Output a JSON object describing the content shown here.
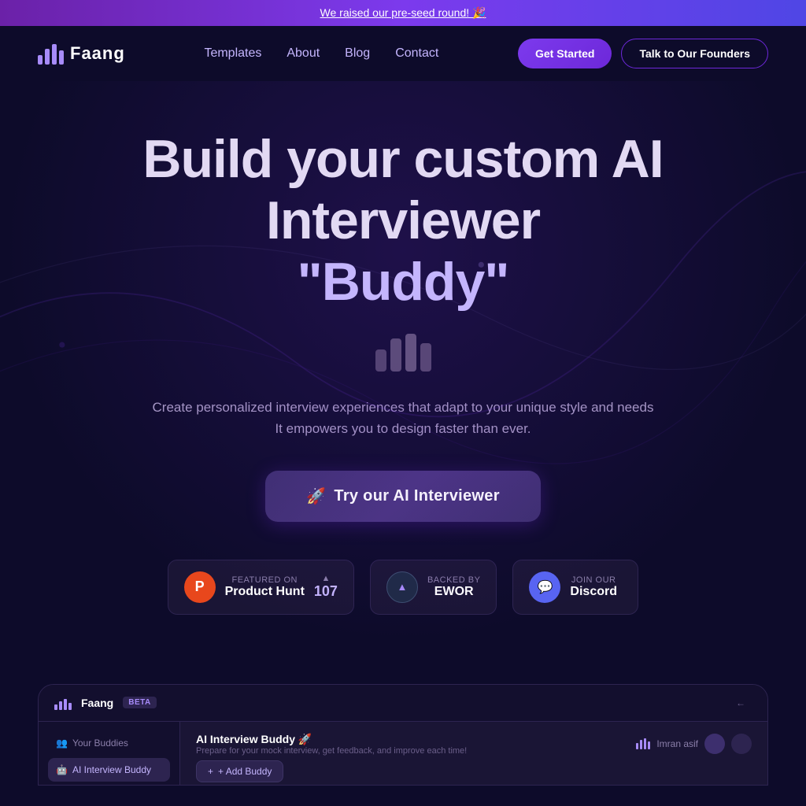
{
  "banner": {
    "text": "We raised our pre-seed round! 🎉"
  },
  "navbar": {
    "logo_text": "Faang",
    "links": [
      {
        "label": "Templates",
        "href": "#"
      },
      {
        "label": "About",
        "href": "#"
      },
      {
        "label": "Blog",
        "href": "#"
      },
      {
        "label": "Contact",
        "href": "#"
      }
    ],
    "btn_get_started": "Get Started",
    "btn_founders": "Talk to Our Founders"
  },
  "hero": {
    "title_line1": "Build your custom AI",
    "title_line2": "Interviewer",
    "title_line3": "\"Buddy\"",
    "subtitle_line1": "Create personalized interview experiences that adapt to your unique style and needs",
    "subtitle_line2": "It empowers you to design faster than ever.",
    "cta_label": "Try our AI Interviewer"
  },
  "badges": [
    {
      "icon_label": "P",
      "icon_style": "ph",
      "small_text": "FEATURED ON",
      "main_text": "Product Hunt",
      "count": "107"
    },
    {
      "icon_label": "▲",
      "icon_style": "ew",
      "small_text": "Backed by",
      "main_text": "EWOR",
      "count": ""
    },
    {
      "icon_label": "💬",
      "icon_style": "ds",
      "small_text": "Join Our",
      "main_text": "Discord",
      "count": ""
    }
  ],
  "app_preview": {
    "logo_text": "Faang",
    "beta_label": "BETA",
    "main_title": "AI Interview Buddy 🚀",
    "main_subtitle": "Prepare for your mock interview, get feedback, and improve each time!",
    "user_name": "Imran asif",
    "nav_item1": "Your Buddies",
    "nav_item2": "AI Interview Buddy",
    "add_buddy_label": "+ Add Buddy"
  }
}
